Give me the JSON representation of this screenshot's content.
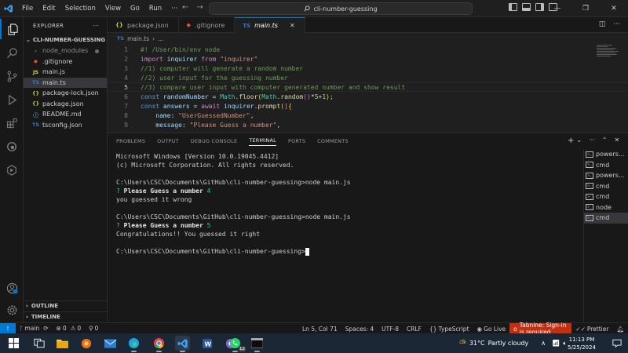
{
  "titlebar": {
    "menu": [
      "File",
      "Edit",
      "Selection",
      "View",
      "Go",
      "Run"
    ],
    "more": "···",
    "search_text": "cli-number-guessing"
  },
  "sidebar": {
    "title": "EXPLORER",
    "more": "···",
    "folder": "CLI-NUMBER-GUESSING",
    "items": [
      {
        "icon": "›",
        "label": "node_modules",
        "dim": true
      },
      {
        "icon": "◆",
        "label": ".gitignore"
      },
      {
        "icon": "JS",
        "label": "main.js"
      },
      {
        "icon": "TS",
        "label": "main.ts",
        "selected": true
      },
      {
        "icon": "{}",
        "label": "package-lock.json"
      },
      {
        "icon": "{}",
        "label": "package.json"
      },
      {
        "icon": "ⓘ",
        "label": "README.md"
      },
      {
        "icon": "TS",
        "label": "tsconfig.json"
      }
    ],
    "outline": "OUTLINE",
    "timeline": "TIMELINE"
  },
  "tabs": [
    {
      "icon": "{}",
      "label": "package.json"
    },
    {
      "icon": "◆",
      "label": ".gitignore"
    },
    {
      "icon": "TS",
      "label": "main.ts",
      "active": true,
      "close": "✕"
    }
  ],
  "breadcrumb": {
    "icon": "TS",
    "file": "main.ts",
    "sep": "›",
    "rest": "..."
  },
  "code": {
    "line_numbers": [
      "1",
      "2",
      "3",
      "4",
      "5",
      "6",
      "7",
      "8",
      "9"
    ],
    "line1": "#! /User/bin/env node",
    "line2_kw": "import",
    "line2_var": "inquirer",
    "line2_from": "from",
    "line2_str": "\"inquirer\"",
    "line3": "//1) computer will generate a random number",
    "line4": "//2) user input for the guessing number",
    "line5": "//3) compare user input with computer generated number and show result",
    "line6_kw": "const",
    "line6_var": "randomNumber",
    "line6_eq": "=",
    "line6_cls": "Math",
    "line6_fn": "floor",
    "line6_cls2": "Math",
    "line6_fn2": "random",
    "line6_num1": "5",
    "line6_num2": "1",
    "line7_kw": "const",
    "line7_var": "answers",
    "line7_eq": "=",
    "line7_await": "await",
    "line7_obj": "inquirer",
    "line7_fn": "prompt",
    "line8_key": "name",
    "line8_str": "\"UserGuessedNumber\"",
    "line9_key": "message",
    "line9_str": "\"Please Guess a number\""
  },
  "panel": {
    "tabs": [
      "PROBLEMS",
      "OUTPUT",
      "DEBUG CONSOLE",
      "TERMINAL",
      "PORTS",
      "COMMENTS"
    ],
    "active_tab": "TERMINAL",
    "terminal_lines": {
      "l1": "Microsoft Windows [Version 10.0.19045.4412]",
      "l2": "(c) Microsoft Corporation. All rights reserved.",
      "l3": "C:\\Users\\CSC\\Documents\\GitHub\\cli-number-guessing>node main.js",
      "l4_q": "?",
      "l4_text": "Please Guess a number",
      "l4_ans": "4",
      "l5": "you guessed it wrong",
      "l6": "C:\\Users\\CSC\\Documents\\GitHub\\cli-number-guessing>node main.js",
      "l7_q": "?",
      "l7_text": "Please Guess a number",
      "l7_ans": "5",
      "l8": "Congratulations!! You guessed it right",
      "l9": "C:\\Users\\CSC\\Documents\\GitHub\\cli-number-guessing>"
    },
    "terminals": [
      "powers...",
      "cmd",
      "powers...",
      "cmd",
      "cmd",
      "node",
      "cmd"
    ]
  },
  "statusbar": {
    "branch": "main",
    "errors": "0",
    "warnings": "0",
    "ports": "0",
    "position": "Ln 5, Col 71",
    "spaces": "Spaces: 4",
    "encoding": "UTF-8",
    "eol": "CRLF",
    "language": "TypeScript",
    "golive": "Go Live",
    "tabnine": "Tabnine: Sign-in is required",
    "prettier": "Prettier"
  },
  "taskbar": {
    "weather_temp": "31°C",
    "weather_text": "Partly cloudy",
    "time": "11:13 PM",
    "date": "5/25/2024",
    "whatsapp_badge": "12"
  },
  "colors": {
    "accent": "#0078d4",
    "tabnine": "#c72e0f",
    "editor_bg": "#1f1f1f",
    "taskbar_bg": "#1c2736"
  }
}
